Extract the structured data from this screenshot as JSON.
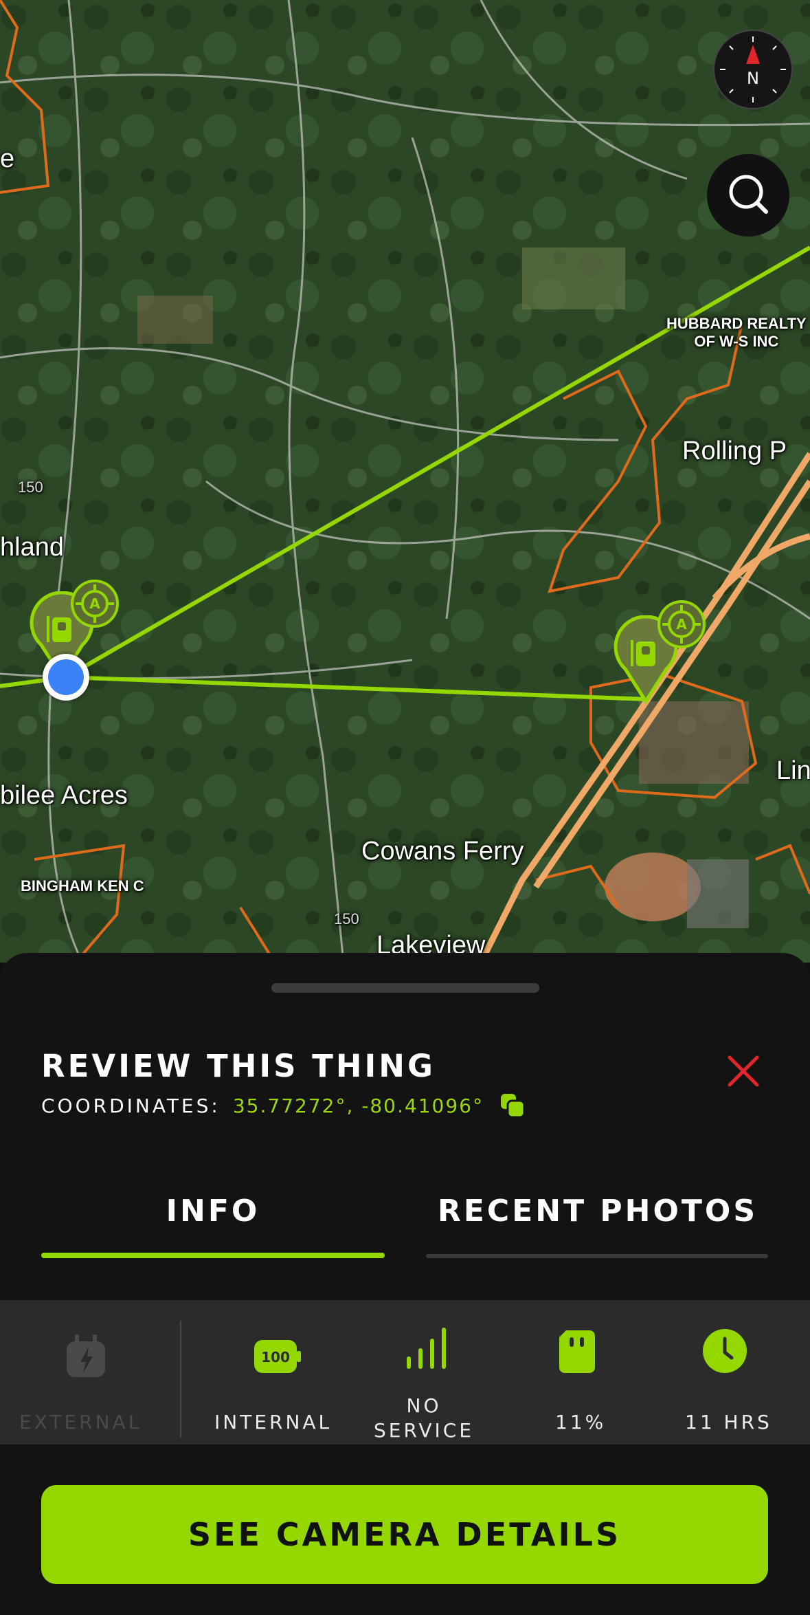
{
  "map": {
    "places": {
      "hubbard": "HUBBARD REALTY\nOF W-S INC",
      "rolling": "Rolling P",
      "highland": "hland",
      "jubilee": "bilee Acres",
      "cowans": "Cowans Ferry",
      "bingham": "BINGHAM KEN C",
      "lakeview": "Lakeview",
      "lin": "Lin",
      "e_partial": "e",
      "road_150_a": "150",
      "road_150_b": "150"
    },
    "compass_letter": "N",
    "colors": {
      "route": "#94d800",
      "parcel": "#e06a1c",
      "highway": "#f0a868",
      "location": "#3b82f6"
    }
  },
  "sheet": {
    "title": "REVIEW THIS THING",
    "coordinates_label": "COORDINATES:",
    "coordinates_value": "35.77272°, -80.41096°",
    "tabs": {
      "info": "INFO",
      "photos": "RECENT PHOTOS"
    },
    "active_tab": "INFO",
    "status": {
      "external": "EXTERNAL",
      "internal": "INTERNAL",
      "internal_level": "100",
      "signal": "NO\nSERVICE",
      "storage": "11%",
      "time": "11 HRS"
    },
    "cta": "SEE CAMERA DETAILS",
    "accent": "#94d800",
    "close_color": "#e0262a"
  }
}
